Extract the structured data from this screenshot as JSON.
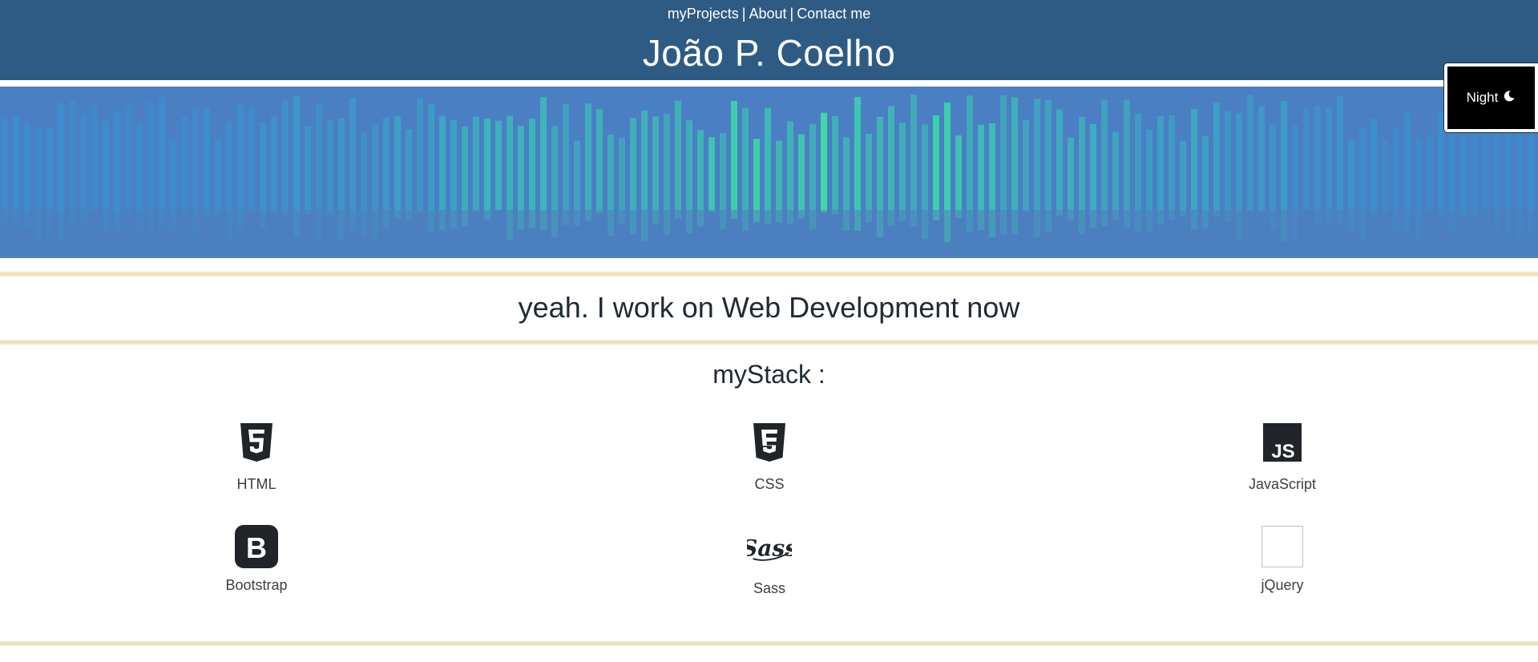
{
  "nav": {
    "items": [
      "myProjects",
      "About",
      "Contact me"
    ],
    "separator": "|"
  },
  "site": {
    "title": "João P. Coelho"
  },
  "night_toggle": {
    "label": "Night",
    "icon": "moon-icon"
  },
  "banner": {
    "description_icon": "banner-image",
    "colors": {
      "base": "#4a7fc4",
      "highlight": "#3ee6a0"
    }
  },
  "tagline": "yeah. I work on Web Development now",
  "stack": {
    "title": "myStack :",
    "items": [
      {
        "label": "HTML",
        "icon": "html5-icon"
      },
      {
        "label": "CSS",
        "icon": "css3-icon"
      },
      {
        "label": "JavaScript",
        "icon": "javascript-icon"
      },
      {
        "label": "Bootstrap",
        "icon": "bootstrap-icon"
      },
      {
        "label": "Sass",
        "icon": "sass-icon"
      },
      {
        "label": "jQuery",
        "icon": "jquery-icon"
      }
    ]
  },
  "colors": {
    "header": "#2e5b84",
    "stripe": "#e8dcae",
    "icon": "#212529"
  }
}
